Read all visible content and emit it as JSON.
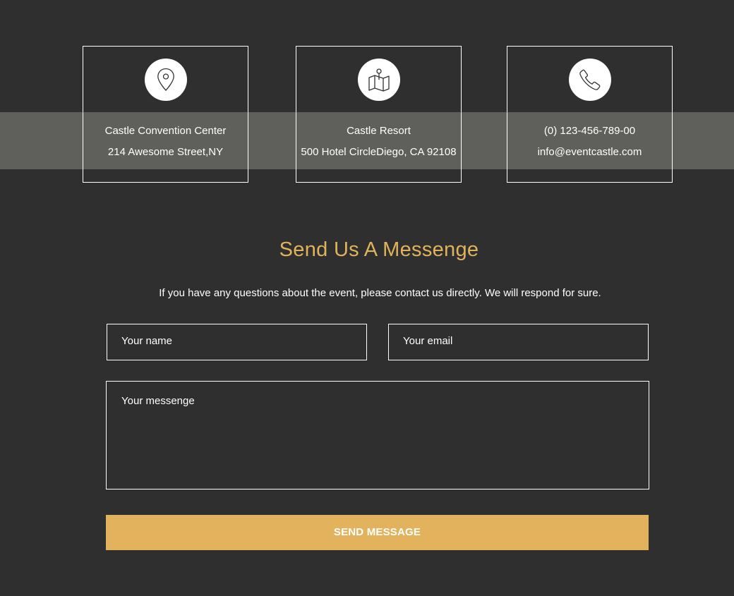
{
  "contact_cards": [
    {
      "icon": "map-pin-icon",
      "line1": "Castle Convention Center",
      "line2": "214 Awesome Street,NY"
    },
    {
      "icon": "map-icon",
      "line1": "Castle Resort",
      "line2": "500 Hotel CircleDiego, CA 92108"
    },
    {
      "icon": "phone-icon",
      "line1": "(0) 123-456-789-00",
      "line2": "info@eventcastle.com"
    }
  ],
  "form": {
    "heading": "Send Us A Messenge",
    "intro": "If you have any questions about the event, please contact us directly. We will respond for sure.",
    "name_placeholder": "Your name",
    "email_placeholder": "Your email",
    "message_placeholder": "Your messenge",
    "submit_label": "SEND MESSAGE"
  },
  "colors": {
    "background": "#2f2f2f",
    "band": "#5f605b",
    "accent": "#e2b35c",
    "heading": "#e0b25c"
  }
}
